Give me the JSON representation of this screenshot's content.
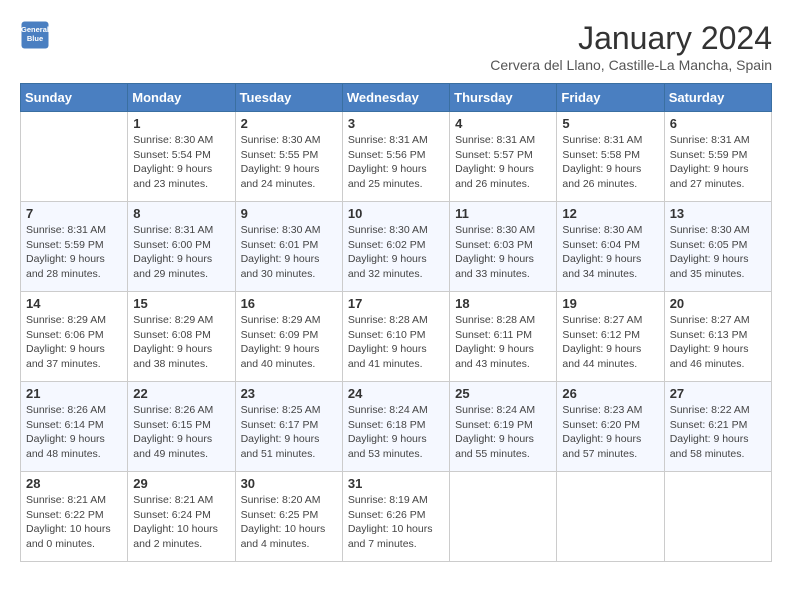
{
  "header": {
    "logo_line1": "General",
    "logo_line2": "Blue",
    "title": "January 2024",
    "subtitle": "Cervera del Llano, Castille-La Mancha, Spain"
  },
  "days_of_week": [
    "Sunday",
    "Monday",
    "Tuesday",
    "Wednesday",
    "Thursday",
    "Friday",
    "Saturday"
  ],
  "weeks": [
    [
      {
        "day": "",
        "empty": true
      },
      {
        "day": "1",
        "sunrise": "Sunrise: 8:30 AM",
        "sunset": "Sunset: 5:54 PM",
        "daylight": "Daylight: 9 hours and 23 minutes."
      },
      {
        "day": "2",
        "sunrise": "Sunrise: 8:30 AM",
        "sunset": "Sunset: 5:55 PM",
        "daylight": "Daylight: 9 hours and 24 minutes."
      },
      {
        "day": "3",
        "sunrise": "Sunrise: 8:31 AM",
        "sunset": "Sunset: 5:56 PM",
        "daylight": "Daylight: 9 hours and 25 minutes."
      },
      {
        "day": "4",
        "sunrise": "Sunrise: 8:31 AM",
        "sunset": "Sunset: 5:57 PM",
        "daylight": "Daylight: 9 hours and 26 minutes."
      },
      {
        "day": "5",
        "sunrise": "Sunrise: 8:31 AM",
        "sunset": "Sunset: 5:58 PM",
        "daylight": "Daylight: 9 hours and 26 minutes."
      },
      {
        "day": "6",
        "sunrise": "Sunrise: 8:31 AM",
        "sunset": "Sunset: 5:59 PM",
        "daylight": "Daylight: 9 hours and 27 minutes."
      }
    ],
    [
      {
        "day": "7",
        "sunrise": "Sunrise: 8:31 AM",
        "sunset": "Sunset: 5:59 PM",
        "daylight": "Daylight: 9 hours and 28 minutes."
      },
      {
        "day": "8",
        "sunrise": "Sunrise: 8:31 AM",
        "sunset": "Sunset: 6:00 PM",
        "daylight": "Daylight: 9 hours and 29 minutes."
      },
      {
        "day": "9",
        "sunrise": "Sunrise: 8:30 AM",
        "sunset": "Sunset: 6:01 PM",
        "daylight": "Daylight: 9 hours and 30 minutes."
      },
      {
        "day": "10",
        "sunrise": "Sunrise: 8:30 AM",
        "sunset": "Sunset: 6:02 PM",
        "daylight": "Daylight: 9 hours and 32 minutes."
      },
      {
        "day": "11",
        "sunrise": "Sunrise: 8:30 AM",
        "sunset": "Sunset: 6:03 PM",
        "daylight": "Daylight: 9 hours and 33 minutes."
      },
      {
        "day": "12",
        "sunrise": "Sunrise: 8:30 AM",
        "sunset": "Sunset: 6:04 PM",
        "daylight": "Daylight: 9 hours and 34 minutes."
      },
      {
        "day": "13",
        "sunrise": "Sunrise: 8:30 AM",
        "sunset": "Sunset: 6:05 PM",
        "daylight": "Daylight: 9 hours and 35 minutes."
      }
    ],
    [
      {
        "day": "14",
        "sunrise": "Sunrise: 8:29 AM",
        "sunset": "Sunset: 6:06 PM",
        "daylight": "Daylight: 9 hours and 37 minutes."
      },
      {
        "day": "15",
        "sunrise": "Sunrise: 8:29 AM",
        "sunset": "Sunset: 6:08 PM",
        "daylight": "Daylight: 9 hours and 38 minutes."
      },
      {
        "day": "16",
        "sunrise": "Sunrise: 8:29 AM",
        "sunset": "Sunset: 6:09 PM",
        "daylight": "Daylight: 9 hours and 40 minutes."
      },
      {
        "day": "17",
        "sunrise": "Sunrise: 8:28 AM",
        "sunset": "Sunset: 6:10 PM",
        "daylight": "Daylight: 9 hours and 41 minutes."
      },
      {
        "day": "18",
        "sunrise": "Sunrise: 8:28 AM",
        "sunset": "Sunset: 6:11 PM",
        "daylight": "Daylight: 9 hours and 43 minutes."
      },
      {
        "day": "19",
        "sunrise": "Sunrise: 8:27 AM",
        "sunset": "Sunset: 6:12 PM",
        "daylight": "Daylight: 9 hours and 44 minutes."
      },
      {
        "day": "20",
        "sunrise": "Sunrise: 8:27 AM",
        "sunset": "Sunset: 6:13 PM",
        "daylight": "Daylight: 9 hours and 46 minutes."
      }
    ],
    [
      {
        "day": "21",
        "sunrise": "Sunrise: 8:26 AM",
        "sunset": "Sunset: 6:14 PM",
        "daylight": "Daylight: 9 hours and 48 minutes."
      },
      {
        "day": "22",
        "sunrise": "Sunrise: 8:26 AM",
        "sunset": "Sunset: 6:15 PM",
        "daylight": "Daylight: 9 hours and 49 minutes."
      },
      {
        "day": "23",
        "sunrise": "Sunrise: 8:25 AM",
        "sunset": "Sunset: 6:17 PM",
        "daylight": "Daylight: 9 hours and 51 minutes."
      },
      {
        "day": "24",
        "sunrise": "Sunrise: 8:24 AM",
        "sunset": "Sunset: 6:18 PM",
        "daylight": "Daylight: 9 hours and 53 minutes."
      },
      {
        "day": "25",
        "sunrise": "Sunrise: 8:24 AM",
        "sunset": "Sunset: 6:19 PM",
        "daylight": "Daylight: 9 hours and 55 minutes."
      },
      {
        "day": "26",
        "sunrise": "Sunrise: 8:23 AM",
        "sunset": "Sunset: 6:20 PM",
        "daylight": "Daylight: 9 hours and 57 minutes."
      },
      {
        "day": "27",
        "sunrise": "Sunrise: 8:22 AM",
        "sunset": "Sunset: 6:21 PM",
        "daylight": "Daylight: 9 hours and 58 minutes."
      }
    ],
    [
      {
        "day": "28",
        "sunrise": "Sunrise: 8:21 AM",
        "sunset": "Sunset: 6:22 PM",
        "daylight": "Daylight: 10 hours and 0 minutes."
      },
      {
        "day": "29",
        "sunrise": "Sunrise: 8:21 AM",
        "sunset": "Sunset: 6:24 PM",
        "daylight": "Daylight: 10 hours and 2 minutes."
      },
      {
        "day": "30",
        "sunrise": "Sunrise: 8:20 AM",
        "sunset": "Sunset: 6:25 PM",
        "daylight": "Daylight: 10 hours and 4 minutes."
      },
      {
        "day": "31",
        "sunrise": "Sunrise: 8:19 AM",
        "sunset": "Sunset: 6:26 PM",
        "daylight": "Daylight: 10 hours and 7 minutes."
      },
      {
        "day": "",
        "empty": true
      },
      {
        "day": "",
        "empty": true
      },
      {
        "day": "",
        "empty": true
      }
    ]
  ]
}
